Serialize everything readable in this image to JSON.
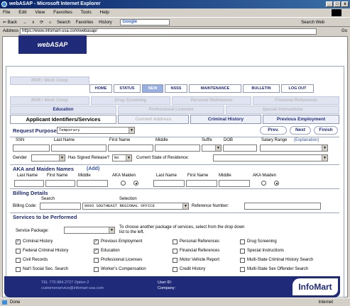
{
  "window": {
    "title": "webASAP - Microsoft Internet Explorer",
    "min": "_",
    "max": "□",
    "close": "x"
  },
  "menu": [
    "File",
    "Edit",
    "View",
    "Favorites",
    "Tools",
    "Help"
  ],
  "toolbar": {
    "back": "⇐ Back",
    "forward": "→",
    "stop": "x",
    "refresh": "⟳",
    "home": "⌂",
    "search": "Search",
    "favorites": "Favorites",
    "history": "History",
    "google": "Google",
    "search_web": "Search Web"
  },
  "address": {
    "label": "Address",
    "url": "https://www.infomart-usa.com/webasap/",
    "go": "Go"
  },
  "logo": "webASAP",
  "nav": [
    "HOME",
    "STATUS",
    "NEW",
    "NSSS",
    "MAINTENANCE",
    "BULLETIN",
    "LOG OUT"
  ],
  "subnav1": [
    "MVR / Work Comp",
    "Drug Screening",
    "Personal References",
    "Financial References"
  ],
  "subnav2": [
    "Education",
    "Professional Licenses",
    "Special Instructions"
  ],
  "tabs": [
    "Applicant Identifiers/Services",
    "Current Address",
    "Criminal History",
    "Previous Employment"
  ],
  "request": {
    "label": "Request Purpose",
    "value": "Temporary",
    "prev": "Prev.",
    "next": "Next",
    "finish": "Finish"
  },
  "applicant": {
    "ssn": "SSN",
    "last": "Last Name",
    "first": "First Name",
    "middle": "Middle",
    "suffix": "Suffix",
    "dob": "DOB",
    "salary": "Salary Range",
    "explanation": "(Explanation)",
    "gender": "Gender",
    "signed": "Has Signed Release?",
    "signed_value": "No",
    "state": "Current State of Residence:"
  },
  "aka": {
    "title": "AKA and Maiden Names",
    "add": "(Add)",
    "cols": [
      "Last Name",
      "First Name",
      "Middle",
      "AKA Maiden",
      "Last Name",
      "First Name",
      "Middle",
      "AKA Maiden"
    ]
  },
  "billing": {
    "title": "Billing Details",
    "search": "Search",
    "selection": "Selection",
    "code_label": "Billing Code:",
    "code_value": "0003 SOUTHEAST REGIONAL OFFICE",
    "ref_label": "Reference Number:"
  },
  "services": {
    "title": "Services to be Performed",
    "package_label": "Service Package:",
    "package_hint": "To choose another package of services, select from the drop down list to the left.",
    "items": [
      {
        "label": "Criminal History",
        "checked": true
      },
      {
        "label": "Previous Employment",
        "checked": true
      },
      {
        "label": "Personal References",
        "checked": false
      },
      {
        "label": "Drug Screening",
        "checked": false
      },
      {
        "label": "Federal Criminal History",
        "checked": false
      },
      {
        "label": "Education",
        "checked": true
      },
      {
        "label": "Financial References",
        "checked": false
      },
      {
        "label": "Special Instructions",
        "checked": false
      },
      {
        "label": "Civil Records",
        "checked": false
      },
      {
        "label": "Professional Licenses",
        "checked": false
      },
      {
        "label": "Motor Vehicle Report",
        "checked": false
      },
      {
        "label": "Multi-State Criminal History Search",
        "checked": false
      },
      {
        "label": "Nat'l Social Sec. Search",
        "checked": false
      },
      {
        "label": "Worker's Compensation",
        "checked": false
      },
      {
        "label": "Credit History",
        "checked": false
      },
      {
        "label": "Multi-State Sex Offender Search",
        "checked": false
      }
    ]
  },
  "footer": {
    "phone": "TEL 770.984.2727 Option 2",
    "email": "customerservice@infomart-usa.com",
    "userid": "User ID:",
    "company": "Company:",
    "brand": "InfoMart"
  },
  "status": {
    "left": "Done",
    "zone": "Internet"
  },
  "colors": {
    "navy": "#1f2a78",
    "accent": "#9ab0e0"
  }
}
